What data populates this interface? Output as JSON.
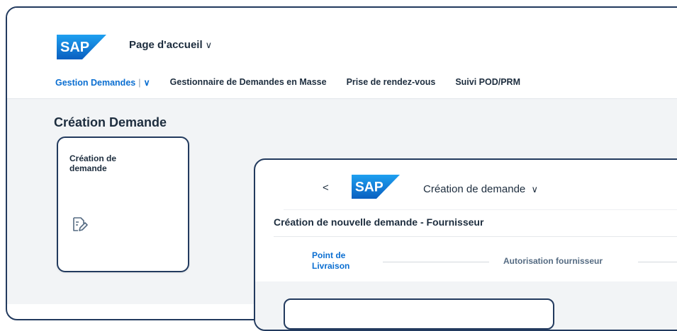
{
  "colors": {
    "accent": "#0a6ed1",
    "frame": "#223a5e",
    "sap_blue": "#0a6ed1"
  },
  "shell": {
    "logo_text": "SAP",
    "home_title": "Page d'accueil",
    "home_chevron": "∨"
  },
  "tabs": [
    {
      "label": "Gestion Demandes",
      "active": true
    },
    {
      "label": "Gestionnaire de Demandes en Masse"
    },
    {
      "label": "Prise de rendez-vous"
    },
    {
      "label": "Suivi POD/PRM"
    }
  ],
  "tab_active_sep": "|",
  "tab_active_chevron": "∨",
  "page": {
    "title": "Création Demande",
    "tile": {
      "title": "Création de demande",
      "icon": "edit-document-icon"
    }
  },
  "inner": {
    "back": "<",
    "logo_text": "SAP",
    "app_title": "Création de demande",
    "app_chevron": "∨",
    "form_title": "Création de nouvelle demande - Fournisseur",
    "steps": [
      {
        "label": "Point de Livraison",
        "active": true
      },
      {
        "label": "Autorisation fournisseur"
      }
    ]
  }
}
